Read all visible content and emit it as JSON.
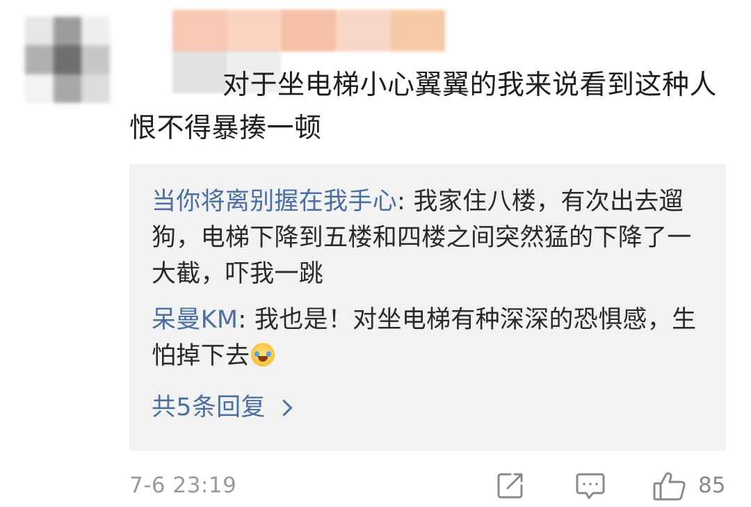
{
  "comment": {
    "text": "对于坐电梯小心翼翼的我来说看到这种人恨不得暴揍一顿"
  },
  "replies": [
    {
      "author": "当你将离别握在我手心",
      "separator": ": ",
      "text": "我家住八楼，有次出去遛狗，电梯下降到五楼和四楼之间突然猛的下降了一大截，吓我一跳"
    },
    {
      "author": "呆曼KM",
      "separator": ": ",
      "text": "我也是！对坐电梯有种深深的恐惧感，生怕掉下去",
      "emoji": "crying-laughing-emoji"
    }
  ],
  "more_replies": {
    "label": "共5条回复"
  },
  "meta": {
    "timestamp": "7-6 23:19",
    "like_count": "85"
  },
  "icons": {
    "share": "share-edit-icon",
    "comment": "comment-bubble-icon",
    "like": "thumbs-up-icon"
  },
  "colors": {
    "link": "#4a6fa5",
    "panel_bg": "#f2f2f2",
    "meta_gray": "#9a9a9a"
  }
}
